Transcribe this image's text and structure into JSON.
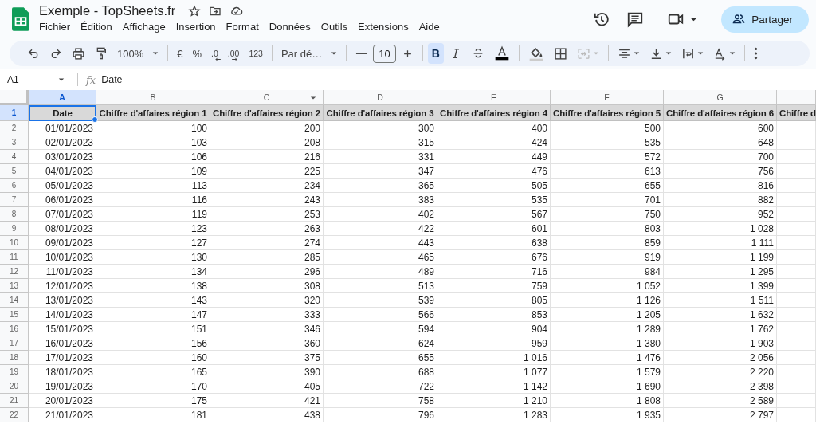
{
  "document": {
    "title": "Exemple - TopSheets.fr"
  },
  "menu": [
    "Fichier",
    "Édition",
    "Affichage",
    "Insertion",
    "Format",
    "Données",
    "Outils",
    "Extensions",
    "Aide"
  ],
  "share_button": {
    "label": "Partager"
  },
  "toolbar": [
    {
      "kind": "undo"
    },
    {
      "kind": "redo"
    },
    {
      "kind": "print"
    },
    {
      "kind": "paint"
    },
    {
      "kind": "zoom",
      "label": "100%",
      "dropdown": true
    },
    {
      "kind": "sep"
    },
    {
      "kind": "currency",
      "label": "€"
    },
    {
      "kind": "percent",
      "label": "%"
    },
    {
      "kind": "decdec",
      "label": ".0"
    },
    {
      "kind": "incdec",
      "label": ".00"
    },
    {
      "kind": "numfmt",
      "label": "123"
    },
    {
      "kind": "sep"
    },
    {
      "kind": "font",
      "label": "Par dé…",
      "dropdown": true
    },
    {
      "kind": "sep"
    },
    {
      "kind": "minus"
    },
    {
      "kind": "size",
      "label": "10"
    },
    {
      "kind": "plus"
    },
    {
      "kind": "sep"
    },
    {
      "kind": "bold",
      "label": "B",
      "selected": true
    },
    {
      "kind": "italic",
      "selected": false
    },
    {
      "kind": "strike",
      "selected": false
    },
    {
      "kind": "textcolor"
    },
    {
      "kind": "sep"
    },
    {
      "kind": "fill"
    },
    {
      "kind": "borders"
    },
    {
      "kind": "merge",
      "dropdown": true,
      "disabled": true
    },
    {
      "kind": "sep"
    },
    {
      "kind": "halign",
      "dropdown": true
    },
    {
      "kind": "valign",
      "dropdown": true
    },
    {
      "kind": "wrap",
      "dropdown": true
    },
    {
      "kind": "rotate",
      "dropdown": true
    },
    {
      "kind": "sep"
    },
    {
      "kind": "more"
    }
  ],
  "formula_bar": {
    "cell_ref": "A1",
    "fx": "fx",
    "value": "Date"
  },
  "sheet": {
    "columns": [
      {
        "letter": "A",
        "selected": true,
        "filter": false
      },
      {
        "letter": "B",
        "selected": false,
        "filter": false
      },
      {
        "letter": "C",
        "selected": false,
        "filter": true
      },
      {
        "letter": "D",
        "selected": false,
        "filter": false
      },
      {
        "letter": "E",
        "selected": false,
        "filter": false
      },
      {
        "letter": "F",
        "selected": false,
        "filter": false
      },
      {
        "letter": "G",
        "selected": false,
        "filter": false
      }
    ],
    "header_row": {
      "number": "1",
      "selected": true,
      "cells": [
        "Date",
        "Chiffre d'affaires région 1",
        "Chiffre d'affaires région 2",
        "Chiffre d'affaires région 3",
        "Chiffre d'affaires région 4",
        "Chiffre d'affaires région 5",
        "Chiffre d'affaires région 6",
        "Chiffre d"
      ]
    },
    "rows": [
      {
        "number": "2",
        "cells": [
          "01/01/2023",
          "100",
          "200",
          "300",
          "400",
          "500",
          "600"
        ]
      },
      {
        "number": "3",
        "cells": [
          "02/01/2023",
          "103",
          "208",
          "315",
          "424",
          "535",
          "648"
        ]
      },
      {
        "number": "4",
        "cells": [
          "03/01/2023",
          "106",
          "216",
          "331",
          "449",
          "572",
          "700"
        ]
      },
      {
        "number": "5",
        "cells": [
          "04/01/2023",
          "109",
          "225",
          "347",
          "476",
          "613",
          "756"
        ]
      },
      {
        "number": "6",
        "cells": [
          "05/01/2023",
          "113",
          "234",
          "365",
          "505",
          "655",
          "816"
        ]
      },
      {
        "number": "7",
        "cells": [
          "06/01/2023",
          "116",
          "243",
          "383",
          "535",
          "701",
          "882"
        ]
      },
      {
        "number": "8",
        "cells": [
          "07/01/2023",
          "119",
          "253",
          "402",
          "567",
          "750",
          "952"
        ]
      },
      {
        "number": "9",
        "cells": [
          "08/01/2023",
          "123",
          "263",
          "422",
          "601",
          "803",
          "1 028"
        ]
      },
      {
        "number": "10",
        "cells": [
          "09/01/2023",
          "127",
          "274",
          "443",
          "638",
          "859",
          "1 111"
        ]
      },
      {
        "number": "11",
        "cells": [
          "10/01/2023",
          "130",
          "285",
          "465",
          "676",
          "919",
          "1 199"
        ]
      },
      {
        "number": "12",
        "cells": [
          "11/01/2023",
          "134",
          "296",
          "489",
          "716",
          "984",
          "1 295"
        ]
      },
      {
        "number": "13",
        "cells": [
          "12/01/2023",
          "138",
          "308",
          "513",
          "759",
          "1 052",
          "1 399"
        ]
      },
      {
        "number": "14",
        "cells": [
          "13/01/2023",
          "143",
          "320",
          "539",
          "805",
          "1 126",
          "1 511"
        ]
      },
      {
        "number": "15",
        "cells": [
          "14/01/2023",
          "147",
          "333",
          "566",
          "853",
          "1 205",
          "1 632"
        ]
      },
      {
        "number": "16",
        "cells": [
          "15/01/2023",
          "151",
          "346",
          "594",
          "904",
          "1 289",
          "1 762"
        ]
      },
      {
        "number": "17",
        "cells": [
          "16/01/2023",
          "156",
          "360",
          "624",
          "959",
          "1 380",
          "1 903"
        ]
      },
      {
        "number": "18",
        "cells": [
          "17/01/2023",
          "160",
          "375",
          "655",
          "1 016",
          "1 476",
          "2 056"
        ]
      },
      {
        "number": "19",
        "cells": [
          "18/01/2023",
          "165",
          "390",
          "688",
          "1 077",
          "1 579",
          "2 220"
        ]
      },
      {
        "number": "20",
        "cells": [
          "19/01/2023",
          "170",
          "405",
          "722",
          "1 142",
          "1 690",
          "2 398"
        ]
      },
      {
        "number": "21",
        "cells": [
          "20/01/2023",
          "175",
          "421",
          "758",
          "1 210",
          "1 808",
          "2 589"
        ]
      },
      {
        "number": "22",
        "cells": [
          "21/01/2023",
          "181",
          "438",
          "796",
          "1 283",
          "1 935",
          "2 797"
        ]
      }
    ]
  }
}
